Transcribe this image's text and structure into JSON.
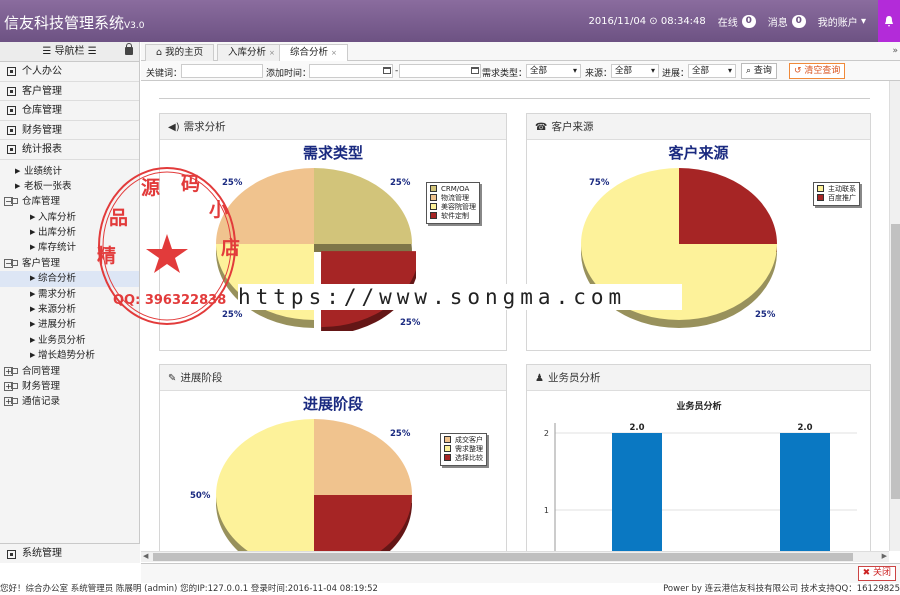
{
  "header": {
    "brand": "信友科技管理系统",
    "version": "V3.0",
    "datetime": "2016/11/04",
    "time": "08:34:48",
    "online_label": "在线",
    "online_count": "0",
    "msg_label": "消息",
    "msg_count": "0",
    "account_label": "我的账户"
  },
  "sidebar": {
    "title": "导航栏",
    "menus": [
      "个人办公",
      "客户管理",
      "仓库管理",
      "财务管理",
      "统计报表"
    ],
    "tree": {
      "biz_stats": "业绩统计",
      "boss_sheet": "老板一张表",
      "warehouse_group": "仓库管理",
      "warehouse_items": [
        "入库分析",
        "出库分析",
        "库存统计"
      ],
      "customer_group": "客户管理",
      "customer_items": [
        "综合分析",
        "需求分析",
        "来源分析",
        "进展分析",
        "业务员分析",
        "增长趋势分析"
      ],
      "contract_group": "合同管理",
      "finance_group": "财务管理",
      "comm_group": "通信记录"
    },
    "bottom": "系统管理"
  },
  "tabs": [
    "我的主页",
    "入库分析",
    "综合分析"
  ],
  "search": {
    "keyword_label": "关键词：",
    "date_label": "添加时间：",
    "demand_label": "需求类型：",
    "demand_value": "全部",
    "source_label": "来源：",
    "source_value": "全部",
    "progress_label": "进展：",
    "progress_value": "全部",
    "query_btn": "查询",
    "clear_btn": "清空查询"
  },
  "panels": {
    "demand": {
      "head": "需求分析",
      "title": "需求类型",
      "legend": [
        {
          "label": "CRM/OA",
          "color": "#d2c47a"
        },
        {
          "label": "物流管理",
          "color": "#f0c38e"
        },
        {
          "label": "美容院管理",
          "color": "#fdf29a"
        },
        {
          "label": "软件定制",
          "color": "#a62525"
        }
      ],
      "pct": [
        "25%",
        "25%",
        "25%",
        "25%"
      ]
    },
    "source": {
      "head": "客户来源",
      "title": "客户来源",
      "legend": [
        {
          "label": "主动联系",
          "color": "#fdf29a"
        },
        {
          "label": "百度推广",
          "color": "#a62525"
        }
      ],
      "pct": [
        "75%",
        "25%"
      ]
    },
    "progress": {
      "head": "进展阶段",
      "title": "进展阶段",
      "legend": [
        {
          "label": "成交客户",
          "color": "#f0c38e"
        },
        {
          "label": "需求整理",
          "color": "#fdf29a"
        },
        {
          "label": "选择比较",
          "color": "#a62525"
        }
      ],
      "pct": [
        "25%",
        "50%"
      ]
    },
    "sales": {
      "head": "业务员分析",
      "title": "业务员分析"
    }
  },
  "chart_data": [
    {
      "type": "pie",
      "title": "需求类型",
      "categories": [
        "CRM/OA",
        "物流管理",
        "美容院管理",
        "软件定制"
      ],
      "values": [
        25,
        25,
        25,
        25
      ]
    },
    {
      "type": "pie",
      "title": "客户来源",
      "categories": [
        "主动联系",
        "百度推广"
      ],
      "values": [
        75,
        25
      ]
    },
    {
      "type": "pie",
      "title": "进展阶段",
      "categories": [
        "成交客户",
        "需求整理",
        "选择比较"
      ],
      "values": [
        25,
        50,
        25
      ]
    },
    {
      "type": "bar",
      "title": "业务员分析",
      "categories": [
        "",
        ""
      ],
      "values": [
        2.0,
        2.0
      ],
      "data_labels": [
        "2.0",
        "2.0"
      ],
      "yticks": [
        "2",
        "1"
      ],
      "ylim": [
        0,
        2.2
      ],
      "color": "#0a78c2"
    }
  ],
  "bottom": {
    "close_btn": "关闭"
  },
  "status": {
    "left": "您好！综合办公室 系统管理员 陈展明 (admin) 您的IP:127.0.0.1 登录时间:2016-11-04 08:19:52",
    "right": "Power by 连云港信友科技有限公司 技术支持QQ：16129825"
  },
  "watermark": {
    "url": "https://www.songma.com",
    "stamp_chars": [
      "精",
      "品",
      "源",
      "码",
      "小",
      "店"
    ],
    "stamp_qq": "QQ: 396322838"
  }
}
